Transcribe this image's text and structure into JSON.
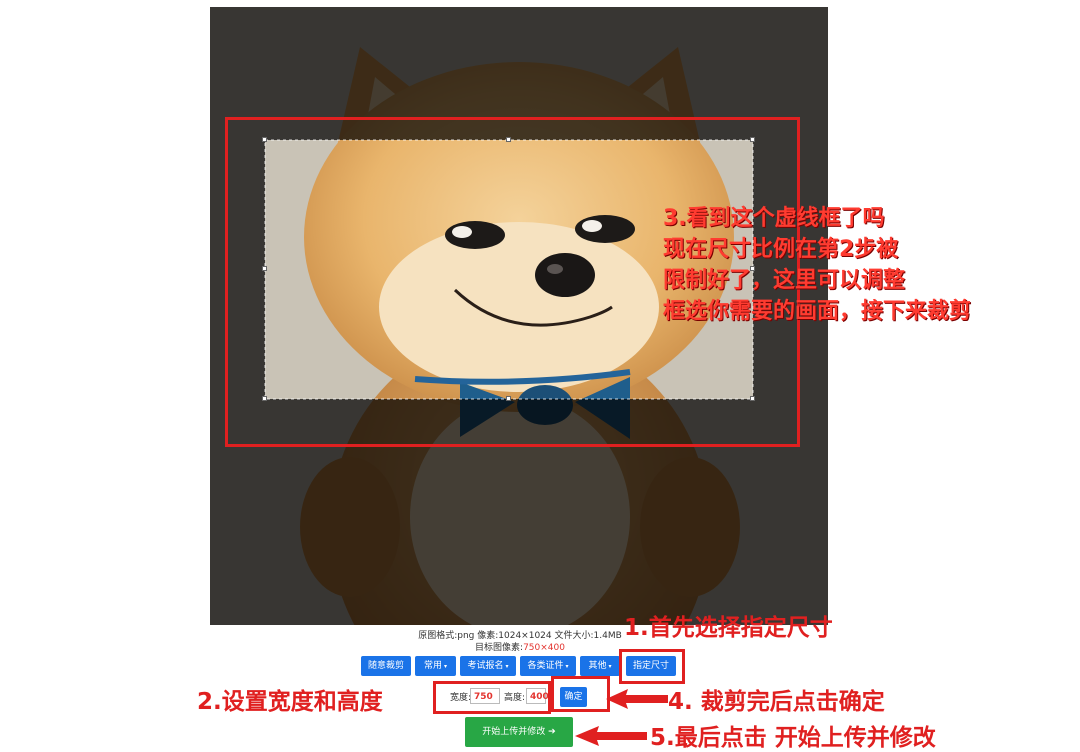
{
  "image_info": {
    "line1": "原图格式:png  像素:1024×1024  文件大小:1.4MB",
    "line2_prefix": "目标图像素:",
    "line2_value": "750×400"
  },
  "toolbar": {
    "random_crop": "随意裁剪",
    "common": "常用",
    "exam": "考试报名",
    "certificates": "各类证件",
    "other": "其他",
    "specified_size": "指定尺寸",
    "caret": "▾"
  },
  "size_form": {
    "width_label": "宽度:",
    "width_value": "750",
    "height_label": "高度:",
    "height_value": "400",
    "confirm": "确定"
  },
  "upload_button": {
    "label": "开始上传并修改",
    "arrow": "➔"
  },
  "annotations": {
    "step1": "1.首先选择指定尺寸",
    "step2": "2.设置宽度和高度",
    "step3_lines": [
      "3.看到这个虚线框了吗",
      "现在尺寸比例在第2步被",
      "限制好了，这里可以调整",
      "框选你需要的画面，接下来裁剪"
    ],
    "step4": "4. 裁剪完后点击确定",
    "step5": "5.最后点击 开始上传并修改"
  },
  "colors": {
    "annotation_red": "#e02020",
    "primary_blue": "#1a73e8",
    "upload_green": "#28a745",
    "value_red": "#e3342f"
  }
}
